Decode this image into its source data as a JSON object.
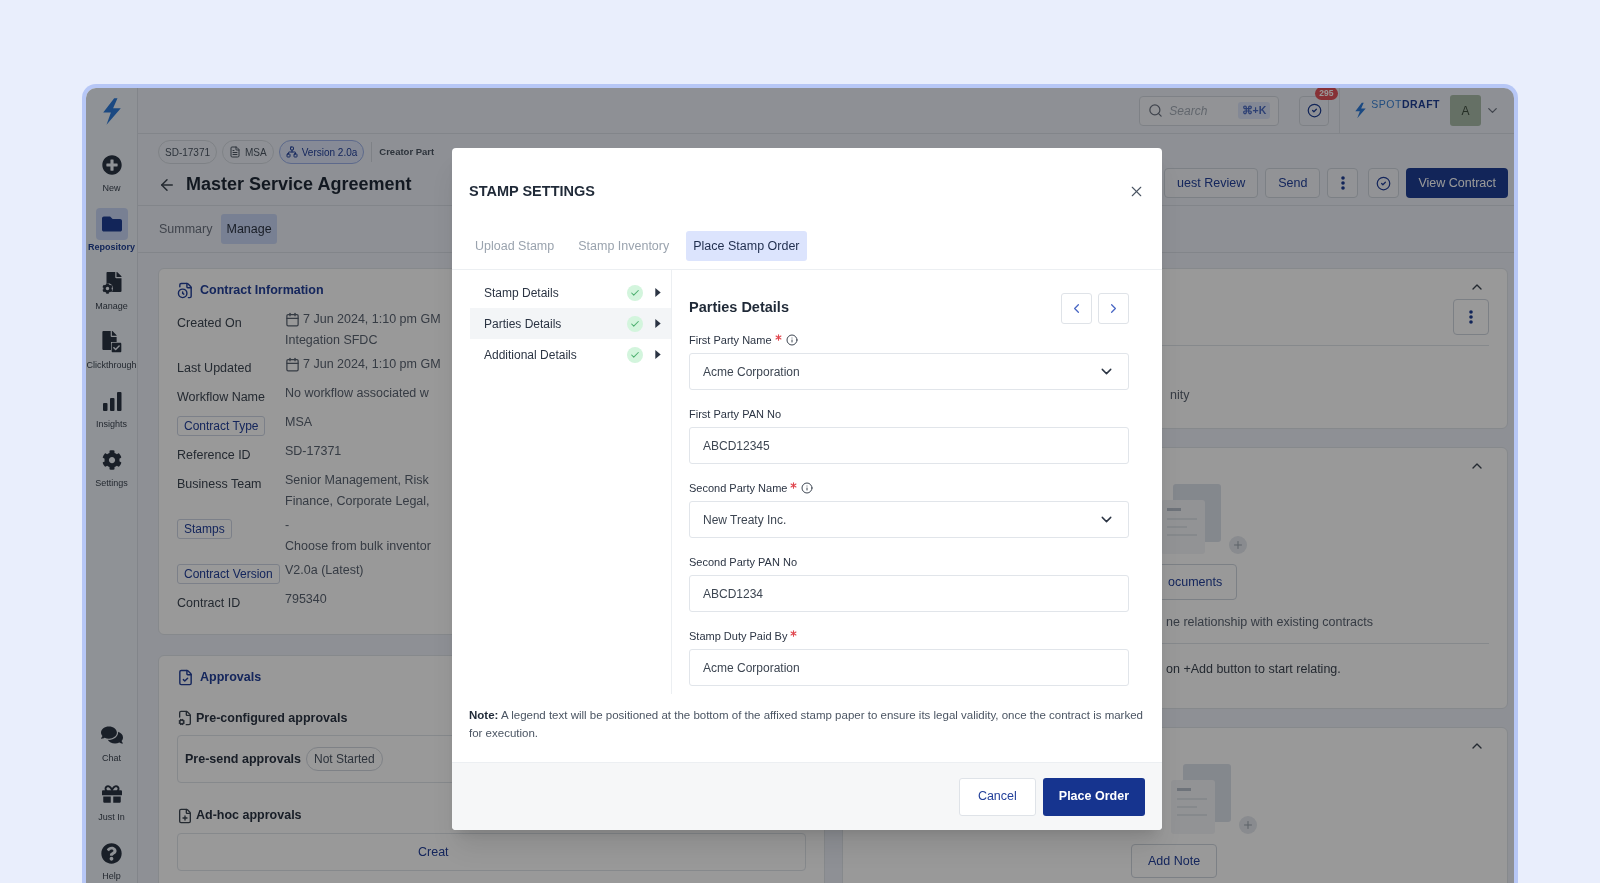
{
  "sidebar": {
    "items": [
      {
        "kind": "new",
        "label": "New",
        "selected": false
      },
      {
        "kind": "repository",
        "label": "Repository",
        "selected": true
      },
      {
        "kind": "manage",
        "label": "Manage",
        "selected": false
      },
      {
        "kind": "clickthrough",
        "label": "Clickthrough",
        "selected": false
      },
      {
        "kind": "insights",
        "label": "Insights",
        "selected": false
      },
      {
        "kind": "settings",
        "label": "Settings",
        "selected": false
      }
    ],
    "bottom_items": [
      {
        "kind": "chat",
        "label": "Chat",
        "selected": false
      },
      {
        "kind": "gift",
        "label": "Just In",
        "selected": false
      },
      {
        "kind": "help",
        "label": "Help",
        "selected": false
      }
    ]
  },
  "header": {
    "search": {
      "placeholder": "Search",
      "shortcut": "⌘+K"
    },
    "notification_count": "295",
    "brand": {
      "light": "SPOT",
      "bold": "DRAFT"
    },
    "avatar": "A"
  },
  "contract": {
    "chips": [
      {
        "kind": "plain",
        "label": "SD-17371"
      },
      {
        "kind": "document",
        "label": "MSA"
      },
      {
        "kind": "version",
        "label": "Version 2.0a"
      }
    ],
    "creator_label": "Creator Part",
    "title": "Master Service Agreement",
    "actions": [
      {
        "kind": "outline",
        "label": "uest Review"
      },
      {
        "kind": "outline",
        "label": "Send"
      },
      {
        "kind": "kebab"
      },
      {
        "kind": "check"
      },
      {
        "kind": "primary",
        "label": "View Contract"
      }
    ],
    "tabs": [
      {
        "label": "Summary",
        "selected": false
      },
      {
        "label": "Manage",
        "selected": true
      }
    ]
  },
  "contract_information": {
    "title": "Contract Information",
    "rows": [
      {
        "kind": "date",
        "label": "Created On",
        "label_tag": false,
        "values": [
          "7 Jun 2024, 1:10 pm GM",
          "Integation SFDC"
        ]
      },
      {
        "kind": "date",
        "label": "Last Updated",
        "label_tag": false,
        "values": [
          "7 Jun 2024, 1:10 pm GM"
        ]
      },
      {
        "kind": "text",
        "label": "Workflow Name",
        "label_tag": false,
        "values": [
          "No workflow associated w"
        ]
      },
      {
        "kind": "text",
        "label": "Contract Type",
        "label_tag": true,
        "values": [
          "MSA"
        ]
      },
      {
        "kind": "text",
        "label": "Reference ID",
        "label_tag": false,
        "values": [
          "SD-17371"
        ]
      },
      {
        "kind": "text",
        "label": "Business Team",
        "label_tag": false,
        "values": [
          "Senior Management, Risk",
          "Finance, Corporate Legal,"
        ]
      },
      {
        "kind": "text",
        "label": "Stamps",
        "label_tag": true,
        "values": [
          "-",
          "Choose from bulk inventor"
        ]
      },
      {
        "kind": "text",
        "label": "Contract Version",
        "label_tag": true,
        "values": [
          "V2.0a (Latest)"
        ]
      },
      {
        "kind": "text",
        "label": "Contract ID",
        "label_tag": false,
        "values": [
          "795340"
        ]
      }
    ]
  },
  "approvals": {
    "title": "Approvals",
    "preconfigured_title": "Pre-configured approvals",
    "presend_label": "Pre-send approvals",
    "presend_status": "Not Started",
    "adhoc_title": "Ad-hoc approvals",
    "adhoc_link": "Creat"
  },
  "right_panels": {
    "panel_1_text": "nity",
    "documents_button": "ocuments",
    "relationship_text": "ne relationship with existing contracts",
    "relating_hint": "on +Add button to start relating.",
    "add_note_button": "Add Note"
  },
  "stamp_settings": {
    "title": "STAMP SETTINGS",
    "tabs": [
      {
        "label": "Upload Stamp",
        "selected": false
      },
      {
        "label": "Stamp Inventory",
        "selected": false
      },
      {
        "label": "Place Stamp Order",
        "selected": true
      }
    ],
    "steps": [
      {
        "label": "Stamp Details",
        "done": true,
        "selected": false
      },
      {
        "label": "Parties Details",
        "done": true,
        "selected": true
      },
      {
        "label": "Additional Details",
        "done": true,
        "selected": false
      }
    ],
    "section_title": "Parties Details",
    "fields": [
      {
        "label": "First Party Name",
        "required": true,
        "info": true,
        "kind": "select",
        "value": "Acme Corporation"
      },
      {
        "label": "First Party PAN No",
        "required": false,
        "info": false,
        "kind": "text",
        "value": "ABCD12345"
      },
      {
        "label": "Second Party Name",
        "required": true,
        "info": true,
        "kind": "select",
        "value": "New Treaty Inc."
      },
      {
        "label": "Second Party PAN No",
        "required": false,
        "info": false,
        "kind": "text",
        "value": "ABCD1234"
      },
      {
        "label": "Stamp Duty Paid By",
        "required": true,
        "info": false,
        "kind": "text",
        "value": "Acme Corporation"
      }
    ],
    "note": "**Note:** A legend text will be positioned at the bottom of the affixed stamp paper to ensure its legal validity, once the contract is marked for execution.",
    "buttons": [
      {
        "kind": "secondary",
        "label": "Cancel"
      },
      {
        "kind": "primary",
        "label": "Place Order"
      }
    ]
  }
}
